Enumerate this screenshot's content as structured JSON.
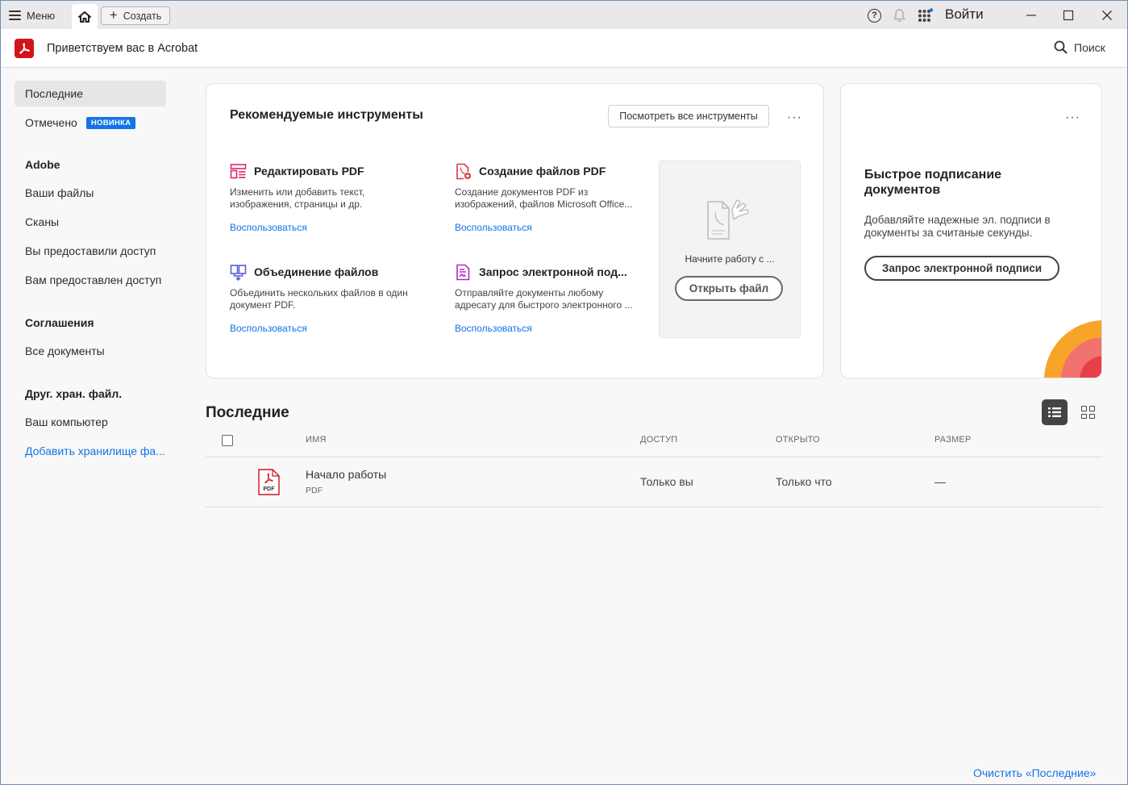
{
  "titlebar": {
    "menu_label": "Меню",
    "create_label": "Создать",
    "signin_label": "Войти"
  },
  "header": {
    "title": "Приветствуем вас в Acrobat",
    "search_label": "Поиск"
  },
  "sidebar": {
    "recent": "Последние",
    "starred": "Отмечено",
    "starred_badge": "НОВИНКА",
    "adobe_section": "Adobe",
    "your_files": "Ваши файлы",
    "scans": "Сканы",
    "shared_by_you": "Вы предоставили доступ",
    "shared_with_you": "Вам предоставлен доступ",
    "agreements_section": "Соглашения",
    "all_documents": "Все документы",
    "other_storage_section": "Друг. хран. файл.",
    "your_computer": "Ваш компьютер",
    "add_storage": "Добавить хранилище фа..."
  },
  "tools_card": {
    "title": "Рекомендуемые инструменты",
    "view_all_label": "Посмотреть все инструменты",
    "tools": [
      {
        "name": "Редактировать PDF",
        "description": "Изменить или добавить текст, изображения, страницы и др.",
        "link": "Воспользоваться",
        "icon": "edit-pdf-icon",
        "color": "#e0246e"
      },
      {
        "name": "Создание файлов PDF",
        "description": "Создание документов PDF из изображений, файлов Microsoft Office...",
        "link": "Воспользоваться",
        "icon": "create-pdf-icon",
        "color": "#d7373f"
      },
      {
        "name": "Объединение файлов",
        "description": "Объединить нескольких файлов в один документ PDF.",
        "link": "Воспользоваться",
        "icon": "combine-files-icon",
        "color": "#5a5fd6"
      },
      {
        "name": "Запрос электронной под...",
        "description": "Отправляйте документы любому адресату для быстрого электронного ...",
        "link": "Воспользоваться",
        "icon": "request-signature-icon",
        "color": "#b62ac8"
      }
    ],
    "get_started_text": "Начните работу с ...",
    "open_file_label": "Открыть файл"
  },
  "sign_card": {
    "title": "Быстрое подписание документов",
    "description": "Добавляйте надежные эл. подписи в документы за считаные секунды.",
    "button_label": "Запрос электронной подписи"
  },
  "recent": {
    "title": "Последние",
    "columns": [
      "ИМЯ",
      "ДОСТУП",
      "ОТКРЫТО",
      "РАЗМЕР"
    ],
    "rows": [
      {
        "name": "Начало работы",
        "type": "PDF",
        "access": "Только вы",
        "opened": "Только что",
        "size": "—"
      }
    ],
    "clear_label": "Очистить «Последние»"
  },
  "colors": {
    "accent": "#1473e6",
    "acrobat_red": "#d1131b"
  }
}
